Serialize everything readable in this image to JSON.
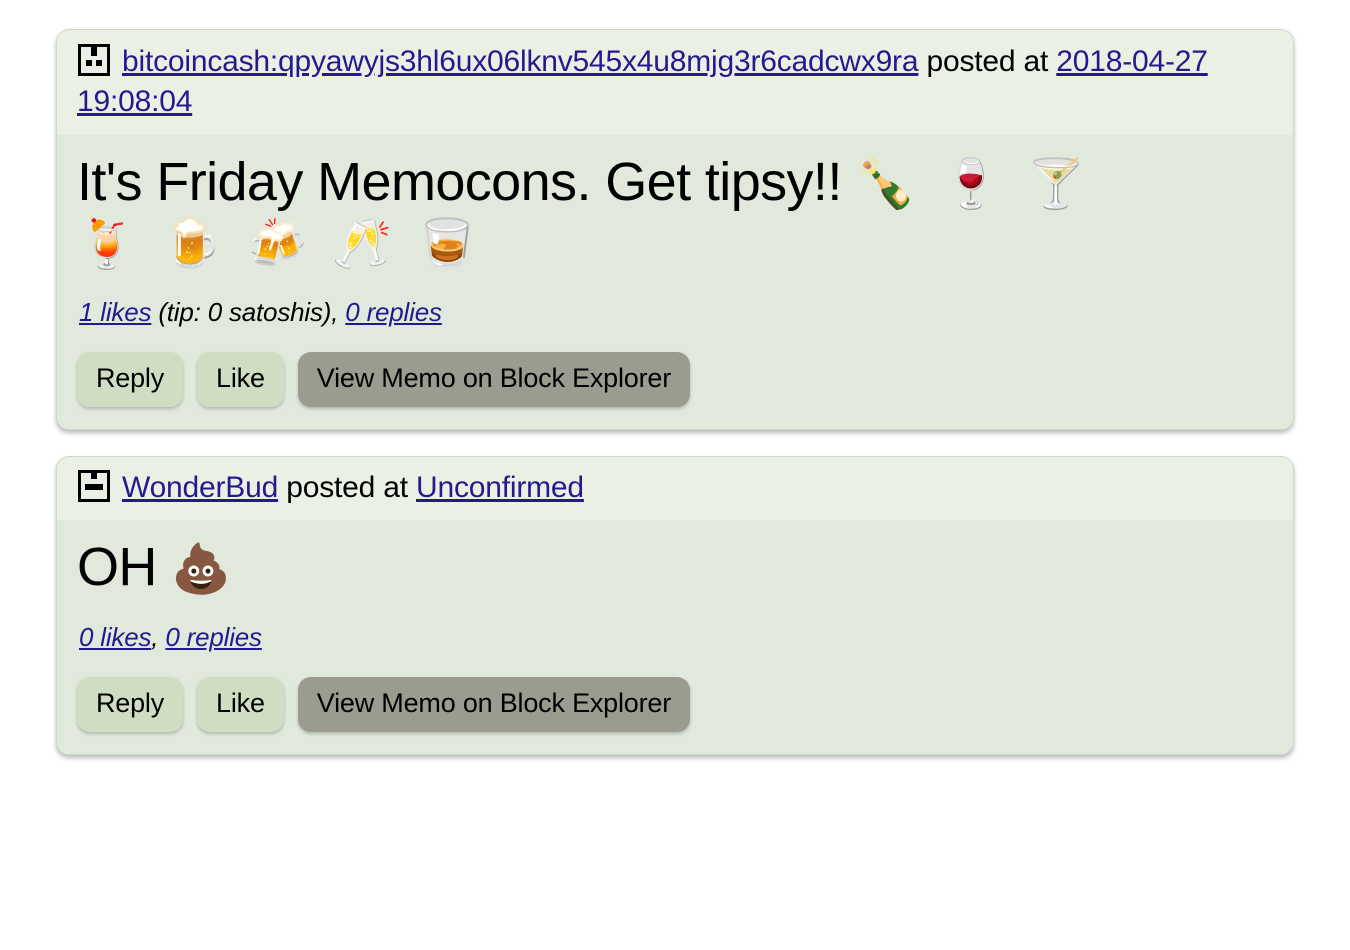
{
  "page": {
    "background": "#ffffff",
    "card_body_color": "#e1e9dc",
    "card_header_color": "#eaf0e4",
    "link_color": "#241a8f",
    "button_light_color": "#cfdec2",
    "button_gray_color": "#9b9b90"
  },
  "posts": [
    {
      "avatar_icon": "identicon-box-two-dots",
      "author": "bitcoincash:qpyawyjs3hl6ux06lknv545x4u8mjg3r6cadcwx9ra",
      "posted_at_label": "posted at",
      "timestamp": "2018-04-27 19:08:04",
      "message_text": "It's Friday Memocons. Get tipsy!!",
      "message_emoji_inline": "🍾 🍷 🍸",
      "message_emoji_row": "🍹 🍺 🍻 🥂 🥃",
      "likes_label": "1 likes",
      "tip_label": "(tip: 0 satoshis),",
      "replies_label": "0 replies",
      "buttons": {
        "reply": "Reply",
        "like": "Like",
        "explorer": "View Memo on Block Explorer"
      }
    },
    {
      "avatar_icon": "identicon-box-one-bar",
      "author": "WonderBud",
      "posted_at_label": "posted at",
      "timestamp": "Unconfirmed",
      "message_text": "OH",
      "message_emoji_inline": "💩",
      "message_emoji_row": "",
      "likes_label": "0 likes",
      "tip_label": ",",
      "replies_label": "0 replies",
      "buttons": {
        "reply": "Reply",
        "like": "Like",
        "explorer": "View Memo on Block Explorer"
      }
    }
  ]
}
